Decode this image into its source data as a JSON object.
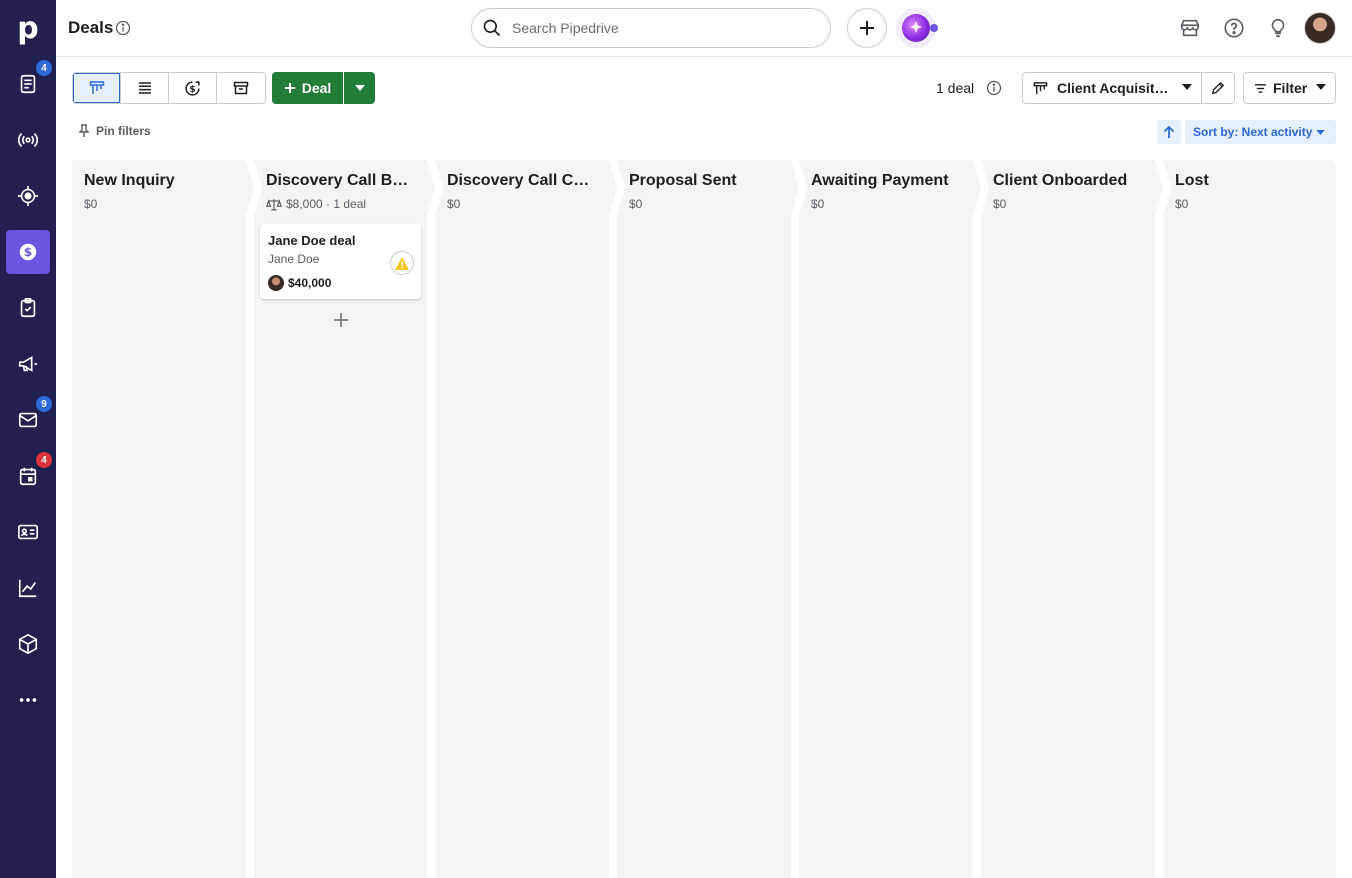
{
  "app": {
    "logo_letter": "p",
    "page_title": "Deals"
  },
  "sidebar": {
    "items": [
      {
        "name": "leads-inbox",
        "icon": "leads-icon",
        "badge": "4",
        "badge_color": "#2d6ad8"
      },
      {
        "name": "activity-feed",
        "icon": "broadcast-icon",
        "badge": ""
      },
      {
        "name": "focus",
        "icon": "target-icon",
        "badge": ""
      },
      {
        "name": "deals",
        "icon": "dollar-icon",
        "badge": "",
        "active": true
      },
      {
        "name": "tasks",
        "icon": "clipboard-check-icon",
        "badge": ""
      },
      {
        "name": "campaigns",
        "icon": "megaphone-icon",
        "badge": ""
      },
      {
        "name": "mail",
        "icon": "mail-icon",
        "badge": "9",
        "badge_color": "#2d6ad8"
      },
      {
        "name": "calendar",
        "icon": "calendar-icon",
        "badge": "4",
        "badge_color": "#d7343b"
      },
      {
        "name": "contacts",
        "icon": "contact-card-icon",
        "badge": ""
      },
      {
        "name": "insights",
        "icon": "chart-icon",
        "badge": ""
      },
      {
        "name": "products",
        "icon": "box-icon",
        "badge": ""
      },
      {
        "name": "more",
        "icon": "more-icon",
        "badge": ""
      }
    ]
  },
  "topbar": {
    "search_placeholder": "Search Pipedrive"
  },
  "toolbar": {
    "deal_button_label": "Deal",
    "deal_count": "1 deal",
    "pipeline_name": "Client Acquisition Pipeline",
    "filter_label": "Filter",
    "pin_filters_label": "Pin filters",
    "sort_label": "Sort by: Next activity"
  },
  "stages": [
    {
      "name": "New Inquiry",
      "sum": "$0"
    },
    {
      "name": "Discovery Call Booked",
      "sum": "$8,000 · 1 deal"
    },
    {
      "name": "Discovery Call Completed",
      "sum": "$0"
    },
    {
      "name": "Proposal Sent",
      "sum": "$0"
    },
    {
      "name": "Awaiting Payment",
      "sum": "$0"
    },
    {
      "name": "Client Onboarded",
      "sum": "$0"
    },
    {
      "name": "Lost",
      "sum": "$0"
    }
  ],
  "deal_card": {
    "title": "Jane Doe deal",
    "person": "Jane Doe",
    "value": "$40,000",
    "status_icon": "warning-icon"
  },
  "colors": {
    "sidebar_bg": "#21204e",
    "active_nav": "#6b55e0",
    "primary_green": "#227d36",
    "link_blue": "#2d6ad8",
    "warning_yellow": "#f5c518"
  }
}
